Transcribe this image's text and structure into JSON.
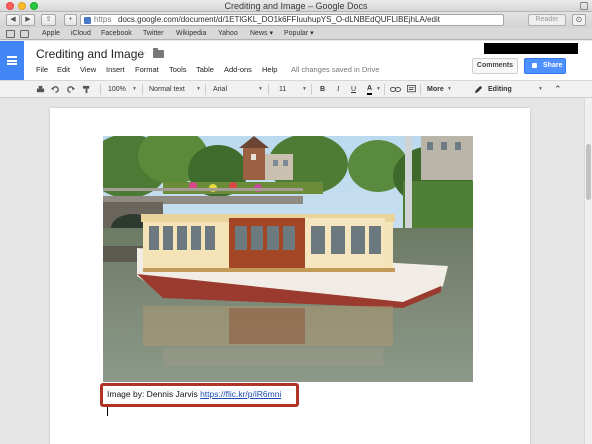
{
  "window": {
    "title": "Crediting and Image – Google Docs"
  },
  "browser": {
    "url_scheme": "https",
    "url_rest": "docs.google.com/document/d/1ETlGKL_DO1k6FFIuuhupYS_O-dLNBEdQUFLIBEjhLA/edit",
    "reader_label": "Reader",
    "bookmarks": [
      {
        "label": "Apple"
      },
      {
        "label": "iCloud"
      },
      {
        "label": "Facebook"
      },
      {
        "label": "Twitter"
      },
      {
        "label": "Wikipedia"
      },
      {
        "label": "Yahoo"
      },
      {
        "label": "News ▾"
      },
      {
        "label": "Popular ▾"
      }
    ]
  },
  "docs": {
    "title": "Crediting and Image",
    "menu": [
      "File",
      "Edit",
      "View",
      "Insert",
      "Format",
      "Tools",
      "Table",
      "Add-ons",
      "Help"
    ],
    "save_status": "All changes saved in Drive",
    "comments_label": "Comments",
    "share_label": "Share",
    "toolbar": {
      "zoom": "100%",
      "style": "Normal text",
      "font": "Arial",
      "size": "11",
      "bold": "B",
      "italic": "I",
      "underline": "U",
      "text_color": "A",
      "more": "More",
      "mode": "Editing"
    }
  },
  "document": {
    "caption_prefix": "Image by: Dennis Jarvis ",
    "caption_link": "https://flic.kr/p/iR6mni"
  },
  "colors": {
    "docs_blue": "#4285f4",
    "share_blue": "#4d90fe",
    "highlight_red": "#b03426",
    "link_blue": "#1a4bb3"
  }
}
